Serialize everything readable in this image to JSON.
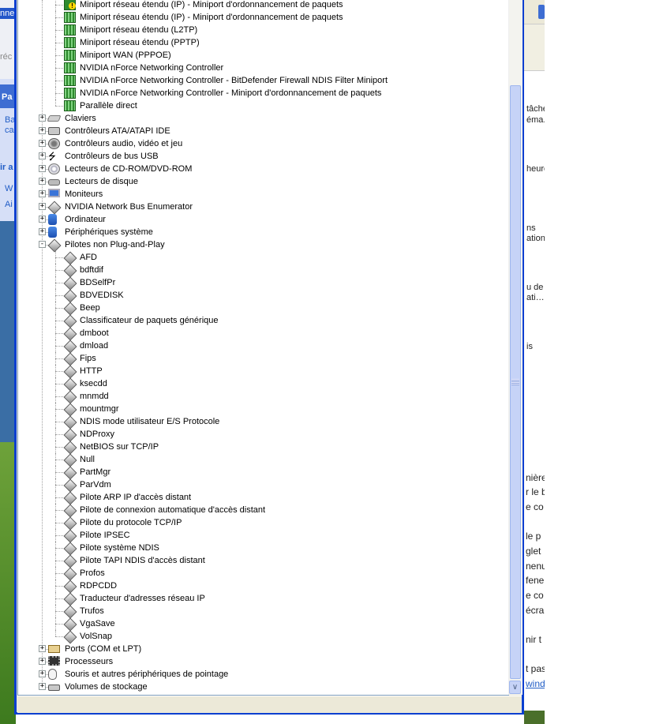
{
  "tree": {
    "rows": [
      {
        "label": "Miniport réseau étendu (IP) - Miniport d'ordonnancement de paquets",
        "level": 2,
        "icon": "network-adapter-warning-icon"
      },
      {
        "label": "Miniport réseau étendu (IP) - Miniport d'ordonnancement de paquets",
        "level": 2,
        "icon": "network-adapter-icon"
      },
      {
        "label": "Miniport réseau étendu (L2TP)",
        "level": 2,
        "icon": "network-adapter-icon"
      },
      {
        "label": "Miniport réseau étendu (PPTP)",
        "level": 2,
        "icon": "network-adapter-icon"
      },
      {
        "label": "Miniport WAN (PPPOE)",
        "level": 2,
        "icon": "network-adapter-icon"
      },
      {
        "label": "NVIDIA nForce Networking Controller",
        "level": 2,
        "icon": "network-adapter-icon"
      },
      {
        "label": "NVIDIA nForce Networking Controller - BitDefender Firewall NDIS Filter Miniport",
        "level": 2,
        "icon": "network-adapter-icon"
      },
      {
        "label": "NVIDIA nForce Networking Controller - Miniport d'ordonnancement de paquets",
        "level": 2,
        "icon": "network-adapter-icon"
      },
      {
        "label": "Parallèle direct",
        "level": 2,
        "icon": "network-adapter-icon",
        "last": true
      },
      {
        "label": "Claviers",
        "level": 1,
        "icon": "keyboard-icon",
        "expander": "+"
      },
      {
        "label": "Contrôleurs ATA/ATAPI IDE",
        "level": 1,
        "icon": "ide-controller-icon",
        "expander": "+"
      },
      {
        "label": "Contrôleurs audio, vidéo et jeu",
        "level": 1,
        "icon": "audio-icon",
        "expander": "+"
      },
      {
        "label": "Contrôleurs de bus USB",
        "level": 1,
        "icon": "usb-icon",
        "expander": "+"
      },
      {
        "label": "Lecteurs de CD-ROM/DVD-ROM",
        "level": 1,
        "icon": "cd-rom-icon",
        "expander": "+"
      },
      {
        "label": "Lecteurs de disque",
        "level": 1,
        "icon": "disk-drive-icon",
        "expander": "+"
      },
      {
        "label": "Moniteurs",
        "level": 1,
        "icon": "monitor-icon",
        "expander": "+"
      },
      {
        "label": "NVIDIA Network Bus Enumerator",
        "level": 1,
        "icon": "device-icon",
        "expander": "+"
      },
      {
        "label": "Ordinateur",
        "level": 1,
        "icon": "computer-icon",
        "expander": "+"
      },
      {
        "label": "Périphériques système",
        "level": 1,
        "icon": "computer-icon",
        "expander": "+"
      },
      {
        "label": "Pilotes non Plug-and-Play",
        "level": 1,
        "icon": "device-icon",
        "expander": "−"
      },
      {
        "label": "AFD",
        "level": 2,
        "icon": "device-icon"
      },
      {
        "label": "bdftdif",
        "level": 2,
        "icon": "device-icon"
      },
      {
        "label": "BDSelfPr",
        "level": 2,
        "icon": "device-icon"
      },
      {
        "label": "BDVEDISK",
        "level": 2,
        "icon": "device-icon"
      },
      {
        "label": "Beep",
        "level": 2,
        "icon": "device-icon"
      },
      {
        "label": "Classificateur de paquets générique",
        "level": 2,
        "icon": "device-icon"
      },
      {
        "label": "dmboot",
        "level": 2,
        "icon": "device-icon"
      },
      {
        "label": "dmload",
        "level": 2,
        "icon": "device-icon"
      },
      {
        "label": "Fips",
        "level": 2,
        "icon": "device-icon"
      },
      {
        "label": "HTTP",
        "level": 2,
        "icon": "device-icon"
      },
      {
        "label": "ksecdd",
        "level": 2,
        "icon": "device-icon"
      },
      {
        "label": "mnmdd",
        "level": 2,
        "icon": "device-icon"
      },
      {
        "label": "mountmgr",
        "level": 2,
        "icon": "device-icon"
      },
      {
        "label": "NDIS mode utilisateur E/S Protocole",
        "level": 2,
        "icon": "device-icon"
      },
      {
        "label": "NDProxy",
        "level": 2,
        "icon": "device-icon"
      },
      {
        "label": "NetBIOS sur TCP/IP",
        "level": 2,
        "icon": "device-icon"
      },
      {
        "label": "Null",
        "level": 2,
        "icon": "device-icon"
      },
      {
        "label": "PartMgr",
        "level": 2,
        "icon": "device-icon"
      },
      {
        "label": "ParVdm",
        "level": 2,
        "icon": "device-icon"
      },
      {
        "label": "Pilote ARP IP d'accès distant",
        "level": 2,
        "icon": "device-icon"
      },
      {
        "label": "Pilote de connexion automatique d'accès distant",
        "level": 2,
        "icon": "device-icon"
      },
      {
        "label": "Pilote du protocole TCP/IP",
        "level": 2,
        "icon": "device-icon"
      },
      {
        "label": "Pilote IPSEC",
        "level": 2,
        "icon": "device-icon"
      },
      {
        "label": "Pilote système NDIS",
        "level": 2,
        "icon": "device-icon"
      },
      {
        "label": "Pilote TAPI NDIS d'accès distant",
        "level": 2,
        "icon": "device-icon"
      },
      {
        "label": "Profos",
        "level": 2,
        "icon": "device-icon"
      },
      {
        "label": "RDPCDD",
        "level": 2,
        "icon": "device-icon"
      },
      {
        "label": "Traducteur d'adresses réseau IP",
        "level": 2,
        "icon": "device-icon"
      },
      {
        "label": "Trufos",
        "level": 2,
        "icon": "device-icon"
      },
      {
        "label": "VgaSave",
        "level": 2,
        "icon": "device-icon"
      },
      {
        "label": "VolSnap",
        "level": 2,
        "icon": "device-icon",
        "last": true
      },
      {
        "label": "Ports (COM et LPT)",
        "level": 1,
        "icon": "port-icon",
        "expander": "+"
      },
      {
        "label": "Processeurs",
        "level": 1,
        "icon": "processor-icon",
        "expander": "+"
      },
      {
        "label": "Souris et autres périphériques de pointage",
        "level": 1,
        "icon": "mouse-icon",
        "expander": "+"
      },
      {
        "label": "Volumes de stockage",
        "level": 1,
        "icon": "storage-volume-icon",
        "expander": "+",
        "last": true
      }
    ]
  },
  "background": {
    "left_fragments": [
      "nne",
      "réc",
      "Pa",
      "Ba",
      "ca",
      "ir a",
      "W",
      "Ai"
    ],
    "right_fragments": [
      "tâche",
      "éma.",
      "heure",
      "ns",
      "ation",
      "u de",
      "ati…",
      "is",
      "nière",
      "r le b",
      "e co",
      "le p",
      "glet",
      "nenu",
      "fene",
      "e co",
      "écran",
      "nir t",
      "t pas",
      "wind"
    ]
  }
}
